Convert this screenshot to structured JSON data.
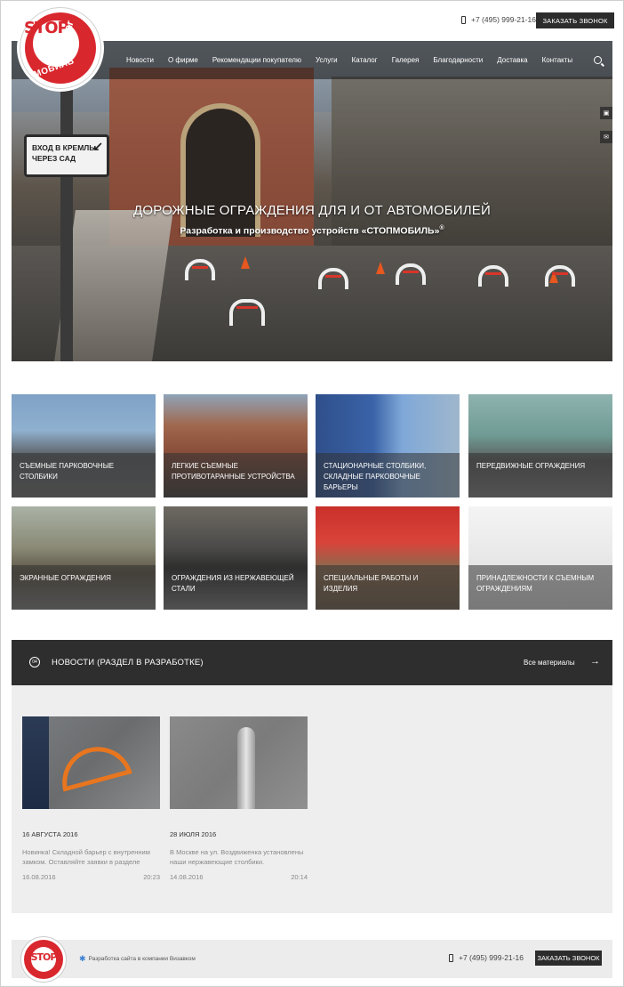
{
  "header": {
    "phone": "+7 (495) 999-21-16",
    "call_button": "ЗАКАЗАТЬ ЗВОНОК"
  },
  "logo": {
    "top": "STOP",
    "side": "car",
    "bottom": "МОБИЛЬ"
  },
  "nav": {
    "items": [
      "Новости",
      "О фирме",
      "Рекомендации покупателю",
      "Услуги",
      "Каталог",
      "Галерея",
      "Благодарности",
      "Доставка",
      "Контакты"
    ]
  },
  "hero": {
    "title": "ДОРОЖНЫЕ ОГРАЖДЕНИЯ ДЛЯ И ОТ АВТОМОБИЛЕЙ",
    "subtitle": "Разработка и производство устройств «СТОПМОБИЛЬ»",
    "registered": "®",
    "sign_line1": "ВХОД В КРЕМЛЬ",
    "sign_line2": "ЧЕРЕЗ САД"
  },
  "catalog": {
    "tiles": [
      {
        "label": "СЪЕМНЫЕ ПАРКОВОЧНЫЕ СТОЛБИКИ"
      },
      {
        "label": "ЛЕГКИЕ СЪЕМНЫЕ ПРОТИВОТАРАННЫЕ УСТРОЙСТВА"
      },
      {
        "label": "СТАЦИОНАРНЫЕ СТОЛБИКИ, СКЛАДНЫЕ ПАРКОВОЧНЫЕ БАРЬЕРЫ"
      },
      {
        "label": "ПЕРЕДВИЖНЫЕ ОГРАЖДЕНИЯ"
      },
      {
        "label": "ЭКРАННЫЕ ОГРАЖДЕНИЯ"
      },
      {
        "label": "ОГРАЖДЕНИЯ ИЗ НЕРЖАВЕЮЩЕЙ СТАЛИ"
      },
      {
        "label": "СПЕЦИАЛЬНЫЕ РАБОТЫ И ИЗДЕЛИЯ"
      },
      {
        "label": "ПРИНАДЛЕЖНОСТИ К СЪЕМНЫМ ОГРАЖДЕНИЯМ"
      }
    ]
  },
  "news": {
    "title": "НОВОСТИ (РАЗДЕЛ В РАЗРАБОТКЕ)",
    "all_link": "Все материалы",
    "arrow": "→",
    "icon_text": "04",
    "items": [
      {
        "date": "16 АВГУСТА 2016",
        "text": "Новинка! Складной барьер с внутренним замком. Оставляйте заявки в разделе",
        "published": "16.08.2016",
        "time": "20:23"
      },
      {
        "date": "28 ИЮЛЯ 2016",
        "text": "В Москве на ул. Воздвиженка установлены наши нержавеющие столбики.",
        "published": "14.08.2016",
        "time": "20:14"
      }
    ]
  },
  "footer": {
    "developer": "Разработка сайта в компании Визавком",
    "phone": "+7 (495) 999-21-16",
    "call_button": "ЗАКАЗАТЬ ЗВОНОК"
  },
  "colors": {
    "brand_red": "#d9272e",
    "dark": "#2c2c2c",
    "news_bg": "#eeeeee"
  }
}
